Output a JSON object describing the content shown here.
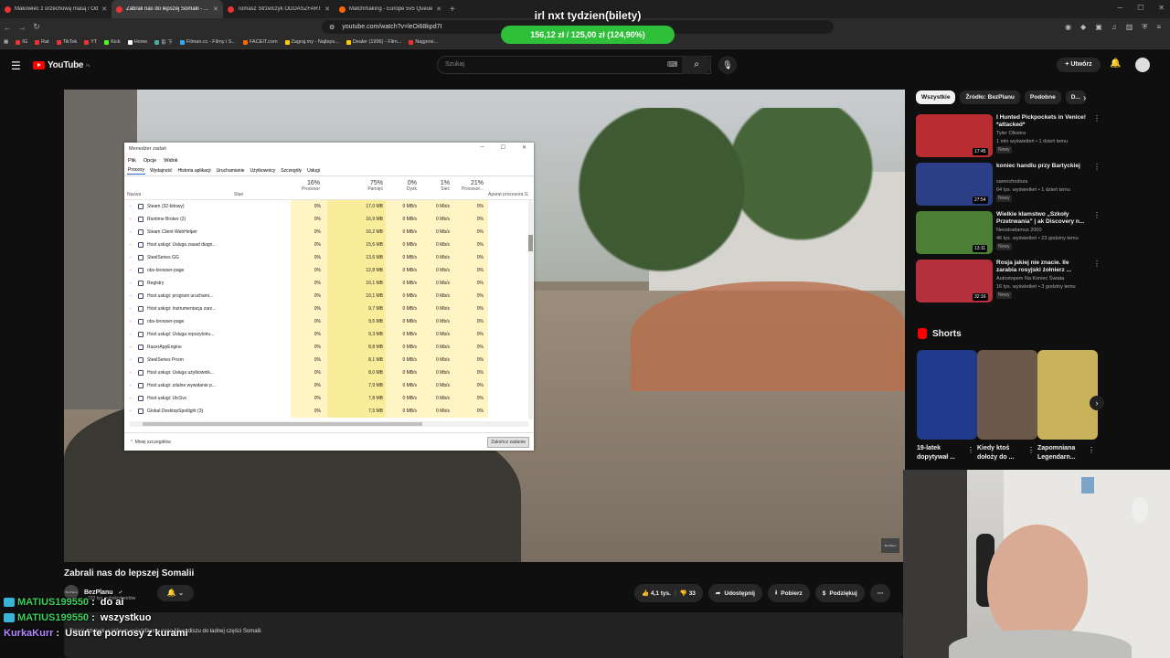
{
  "browser": {
    "tabs": [
      {
        "title": "Makowiec z orzechową masą / Odd..."
      },
      {
        "title": "Zabrali nas do lepszej Somalii - ..."
      },
      {
        "title": "Tomasz Strzelczyk ODDASZFARTUCH"
      },
      {
        "title": "Matchmaking - Europe 5v5 Queue -"
      }
    ],
    "newtab": "+",
    "url": "youtube.com/watch?v=leOi68kpd7I",
    "bookmarks": [
      "IG",
      "Rat",
      "TikTok",
      "YT",
      "Kick",
      "Home",
      "影 下",
      "Filman.cc - Filmy i S...",
      "FACEIT.com",
      "Zagraj.my - Najleps...",
      "Dealer (1996) - Film...",
      "Najgorsi..."
    ]
  },
  "overlay": {
    "title": "irl nxt tydzien(bilety)",
    "progress": "156,12 zł / 125,00 zł (124,90%)",
    "progress_pct": 124.9,
    "color": "#2fc03a"
  },
  "youtube": {
    "logo": "YouTube",
    "region": "PL",
    "search_placeholder": "Szukaj",
    "create_label": "Utwórz"
  },
  "taskmgr": {
    "title": "Menedżer zadań",
    "menu": [
      "Plik",
      "Opcje",
      "Widok"
    ],
    "tabs": [
      "Procesy",
      "Wydajność",
      "Historia aplikacji",
      "Uruchamianie",
      "Użytkownicy",
      "Szczegóły",
      "Usługi"
    ],
    "columns": [
      {
        "label": "Nazwa",
        "pct": ""
      },
      {
        "label": "Stan",
        "pct": ""
      },
      {
        "label": "Procesor",
        "pct": "16%"
      },
      {
        "label": "Pamięć",
        "pct": "75%"
      },
      {
        "label": "Dysk",
        "pct": "0%"
      },
      {
        "label": "Sieć",
        "pct": "1%"
      },
      {
        "label": "Procesor...",
        "pct": "21%"
      },
      {
        "label": "Aparat procesora G",
        "pct": ""
      }
    ],
    "rows": [
      {
        "name": "Steam (32-bitowy)",
        "cpu": "0%",
        "mem": "17,0 MB",
        "disk": "0 MB/s",
        "net": "0 Mb/s",
        "gpu": "0%"
      },
      {
        "name": "Runtime Broker (2)",
        "cpu": "0%",
        "mem": "16,9 MB",
        "disk": "0 MB/s",
        "net": "0 Mb/s",
        "gpu": "0%"
      },
      {
        "name": "Steam Client WebHelper",
        "cpu": "0%",
        "mem": "16,2 MB",
        "disk": "0 MB/s",
        "net": "0 Mb/s",
        "gpu": "0%"
      },
      {
        "name": "Host usługi: Usługa zasad diagn...",
        "cpu": "0%",
        "mem": "15,6 MB",
        "disk": "0 MB/s",
        "net": "0 Mb/s",
        "gpu": "0%"
      },
      {
        "name": "SteelSeries GG",
        "cpu": "0%",
        "mem": "13,6 MB",
        "disk": "0 MB/s",
        "net": "0 Mb/s",
        "gpu": "0%"
      },
      {
        "name": "obs-browser-page",
        "cpu": "0%",
        "mem": "12,8 MB",
        "disk": "0 MB/s",
        "net": "0 Mb/s",
        "gpu": "0%"
      },
      {
        "name": "Registry",
        "cpu": "0%",
        "mem": "10,1 MB",
        "disk": "0 MB/s",
        "net": "0 Mb/s",
        "gpu": "0%"
      },
      {
        "name": "Host usługi: program uruchami...",
        "cpu": "0%",
        "mem": "10,1 MB",
        "disk": "0 MB/s",
        "net": "0 Mb/s",
        "gpu": "0%"
      },
      {
        "name": "Host usługi: Instrumentacja zarz...",
        "cpu": "0%",
        "mem": "9,7 MB",
        "disk": "0 MB/s",
        "net": "0 Mb/s",
        "gpu": "0%"
      },
      {
        "name": "obs-browser-page",
        "cpu": "0%",
        "mem": "9,5 MB",
        "disk": "0 MB/s",
        "net": "0 Mb/s",
        "gpu": "0%"
      },
      {
        "name": "Host usługi: Usługa repozytoriu...",
        "cpu": "0%",
        "mem": "9,3 MB",
        "disk": "0 MB/s",
        "net": "0 Mb/s",
        "gpu": "0%"
      },
      {
        "name": "RazerAppEngine",
        "cpu": "0%",
        "mem": "8,8 MB",
        "disk": "0 MB/s",
        "net": "0 Mb/s",
        "gpu": "0%"
      },
      {
        "name": "SteelSeries Prism",
        "cpu": "0%",
        "mem": "8,1 MB",
        "disk": "0 MB/s",
        "net": "0 Mb/s",
        "gpu": "0%"
      },
      {
        "name": "Host usługi: Usługa użytkownik...",
        "cpu": "0%",
        "mem": "8,0 MB",
        "disk": "0 MB/s",
        "net": "0 Mb/s",
        "gpu": "0%"
      },
      {
        "name": "Host usługi: zdalne wywołanie p...",
        "cpu": "0%",
        "mem": "7,9 MB",
        "disk": "0 MB/s",
        "net": "0 Mb/s",
        "gpu": "0%"
      },
      {
        "name": "Host usługi: UtcSvc",
        "cpu": "0%",
        "mem": "7,8 MB",
        "disk": "0 MB/s",
        "net": "0 Mb/s",
        "gpu": "0%"
      },
      {
        "name": "Global.DesktopSpotlight (3)",
        "cpu": "0%",
        "mem": "7,5 MB",
        "disk": "0 MB/s",
        "net": "0 Mb/s",
        "gpu": "0%"
      }
    ],
    "footer_less": "Mniej szczegółów",
    "footer_end": "Zakończ zadanie"
  },
  "chips": [
    "Wszystkie",
    "Źródło: BezPlanu",
    "Podobne",
    "D..."
  ],
  "recommendations": [
    {
      "title": "I Hunted Pickpockets in Venice! *attacked*",
      "channel": "Tyler Oliveira",
      "meta": "1 mln wyświetleń • 1 dzień temu",
      "badge": "Nowy",
      "duration": "17:45",
      "color": "#b92c32"
    },
    {
      "title": "koniec handlu przy Bartyckiej",
      "channel": "samochodoza",
      "meta": "64 tys. wyświetleń • 1 dzień temu",
      "badge": "Nowy",
      "duration": "27:54",
      "color": "#2c3f86"
    },
    {
      "title": "Wielkie kłamstwo „Szkoły Przetrwania\" | ak Discovery n...",
      "channel": "Neostradamus 2000",
      "meta": "46 tys. wyświetleń • 23 godziny temu",
      "badge": "Nowy",
      "duration": "13:11",
      "color": "#4b7f36"
    },
    {
      "title": "Rosja jakiej nie znacie. Ile zarabia rosyjski żołnierz ...",
      "channel": "Autostopem Na Koniec Świata",
      "meta": "16 tys. wyświetleń • 3 godziny temu",
      "badge": "Nowy",
      "duration": "32:16",
      "color": "#b3303c"
    }
  ],
  "shorts": {
    "header": "Shorts",
    "items": [
      {
        "title": "19-latek dopytywał ...",
        "color": "#1f3a8a"
      },
      {
        "title": "Kiedy ktoś dołoży do ...",
        "color": "#6b5a4a"
      },
      {
        "title": "Zapomniana Legendarn...",
        "color": "#c9b25a"
      }
    ]
  },
  "video": {
    "title": "Zabrali nas do lepszej Somalii",
    "channel": "BezPlanu",
    "subscribers": "232 tys. subskrybentów",
    "likes": "4,1 tys.",
    "dislikes": "33",
    "share": "Udostępnij",
    "download": "Pobierz",
    "thanks": "Podziękuj",
    "description": "Trzeci odcinek w którym wyjeżdżamy poza Mogadiszu do ładnej części Somalii",
    "watermark": "BezPlanu"
  },
  "chat": [
    {
      "user": "MATIUS199550",
      "sep": ": ",
      "text": "do ai",
      "user_color": "#3fcf5e"
    },
    {
      "user": "MATIUS199550",
      "sep": ": ",
      "text": "wszystkuo",
      "user_color": "#3fcf5e"
    },
    {
      "user": "KurkaKurr",
      "sep": ": ",
      "text": "Usuń te pornosy z kurami",
      "user_color": "#b888ff"
    }
  ]
}
